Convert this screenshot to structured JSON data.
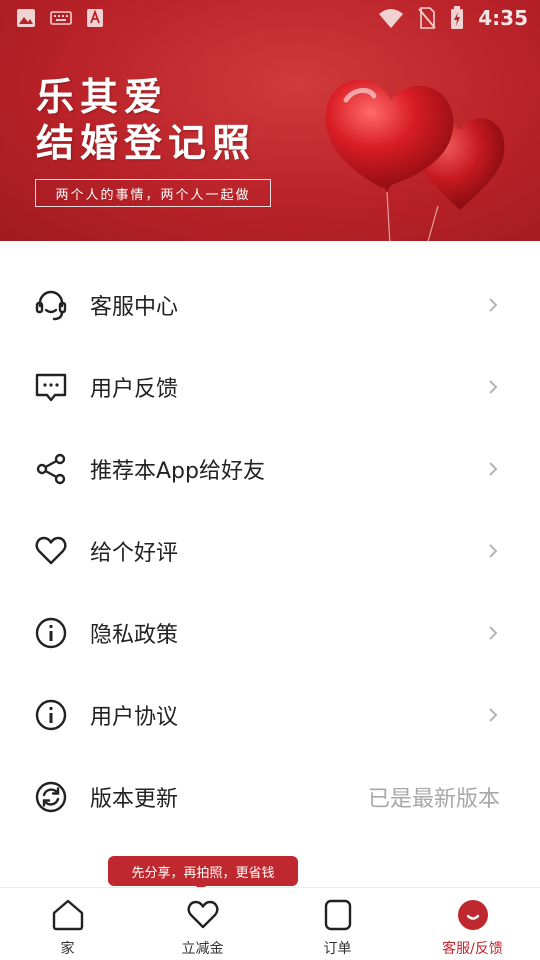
{
  "status_bar": {
    "time": "4:35",
    "icons": [
      "image-icon",
      "keyboard-icon",
      "text-a-icon",
      "wifi-icon",
      "no-sim-icon",
      "battery-charging-icon"
    ]
  },
  "banner": {
    "title_line1": "乐其爱",
    "title_line2": "结婚登记照",
    "slogan": "两个人的事情，两个人一起做",
    "decoration": "red-heart-balloons"
  },
  "menu": {
    "items": [
      {
        "label": "客服中心",
        "icon": "headset-icon",
        "trailing": "chevron"
      },
      {
        "label": "用户反馈",
        "icon": "chat-bubble-icon",
        "trailing": "chevron"
      },
      {
        "label": "推荐本App给好友",
        "icon": "share-icon",
        "trailing": "chevron"
      },
      {
        "label": "给个好评",
        "icon": "heart-icon",
        "trailing": "chevron"
      },
      {
        "label": "隐私政策",
        "icon": "info-icon",
        "trailing": "chevron"
      },
      {
        "label": "用户协议",
        "icon": "info-icon",
        "trailing": "chevron"
      },
      {
        "label": "版本更新",
        "icon": "refresh-icon",
        "trailing_text": "已是最新版本"
      }
    ]
  },
  "tooltip": {
    "text": "先分享，再拍照，更省钱"
  },
  "bottom_nav": {
    "items": [
      {
        "label": "家",
        "icon": "home-icon",
        "active": false
      },
      {
        "label": "立减金",
        "icon": "heart-icon",
        "active": false
      },
      {
        "label": "订单",
        "icon": "order-icon",
        "active": false
      },
      {
        "label": "客服/反馈",
        "icon": "smile-icon",
        "active": true
      }
    ]
  },
  "colors": {
    "brand_red": "#c0282f",
    "banner_red": "#b92228",
    "text_primary": "#222222",
    "text_secondary": "#a8a8a8"
  }
}
